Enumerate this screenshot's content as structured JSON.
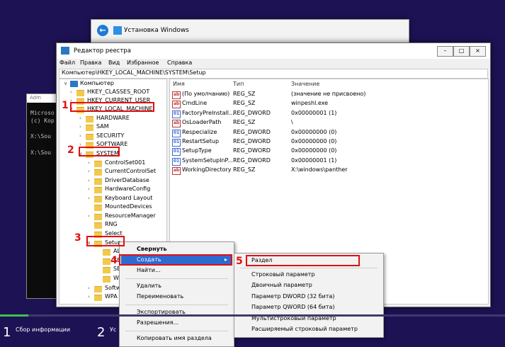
{
  "setup_window": {
    "title": "Установка Windows"
  },
  "console": {
    "title": "Adm",
    "lines": [
      "Microso",
      "(c) Кор",
      "",
      "X:\\Sou",
      "",
      "X:\\Sou"
    ]
  },
  "regedit": {
    "title": "Редактор реестра",
    "menu": [
      "Файл",
      "Правка",
      "Вид",
      "Избранное",
      "Справка"
    ],
    "address": "Компьютер\\HKEY_LOCAL_MACHINE\\SYSTEM\\Setup",
    "tree": {
      "root": "Компьютер",
      "hkcr": "HKEY_CLASSES_ROOT",
      "hkcu": "HKEY_CURRENT_USER",
      "hklm": "HKEY_LOCAL_MACHINE",
      "hardware": "HARDWARE",
      "sam": "SAM",
      "security": "SECURITY",
      "software": "SOFTWARE",
      "system": "SYSTEM",
      "cs001": "ControlSet001",
      "ccs": "CurrentControlSet",
      "driverdb": "DriverDatabase",
      "hwcfg": "HardwareConfig",
      "kbd": "Keyboard Layout",
      "mdev": "MountedDevices",
      "resmgr": "ResourceManager",
      "rng": "RNG",
      "select": "Select",
      "setup": "Setup",
      "s1": "AL",
      "s2": "SE",
      "s3": "SE",
      "s4": "W",
      "softw": "Softw",
      "wpa": "WPA"
    },
    "columns": {
      "name": "Имя",
      "type": "Тип",
      "value": "Значение"
    },
    "values": [
      {
        "name": "(По умолчанию)",
        "type": "REG_SZ",
        "data": "(значение не присвоено)",
        "icon": "ab"
      },
      {
        "name": "CmdLine",
        "type": "REG_SZ",
        "data": "winpeshl.exe",
        "icon": "ab"
      },
      {
        "name": "FactoryPreInstall...",
        "type": "REG_DWORD",
        "data": "0x00000001 (1)",
        "icon": "bin"
      },
      {
        "name": "OsLoaderPath",
        "type": "REG_SZ",
        "data": "\\",
        "icon": "ab"
      },
      {
        "name": "Respecialize",
        "type": "REG_DWORD",
        "data": "0x00000000 (0)",
        "icon": "bin"
      },
      {
        "name": "RestartSetup",
        "type": "REG_DWORD",
        "data": "0x00000000 (0)",
        "icon": "bin"
      },
      {
        "name": "SetupType",
        "type": "REG_DWORD",
        "data": "0x00000000 (0)",
        "icon": "bin"
      },
      {
        "name": "SystemSetupInP...",
        "type": "REG_DWORD",
        "data": "0x00000001 (1)",
        "icon": "bin"
      },
      {
        "name": "WorkingDirectory",
        "type": "REG_SZ",
        "data": "X:\\windows\\panther",
        "icon": "ab"
      }
    ]
  },
  "context_menu": {
    "collapse": "Свернуть",
    "create": "Создать",
    "find": "Найти...",
    "delete": "Удалить",
    "rename": "Переименовать",
    "export": "Экспортировать",
    "permissions": "Разрешения...",
    "copy_name": "Копировать имя раздела"
  },
  "submenu": {
    "key": "Раздел",
    "string": "Строковый параметр",
    "binary": "Двоичный параметр",
    "dword": "Параметр DWORD (32 бита)",
    "qword": "Параметр QWORD (64 бита)",
    "multi": "Мультистроковый параметр",
    "expand": "Расширяемый строковый параметр"
  },
  "annotations": [
    "1",
    "2",
    "3",
    "4",
    "5"
  ],
  "bottom": {
    "step1_num": "1",
    "step1_label": "Сбор информации",
    "step2_num": "2",
    "step2_label": "Ус"
  },
  "colors": {
    "highlight_red": "#e01010",
    "selection_blue": "#2f6ad0",
    "progress_green": "#3ec24b",
    "background": "#1d1254"
  }
}
